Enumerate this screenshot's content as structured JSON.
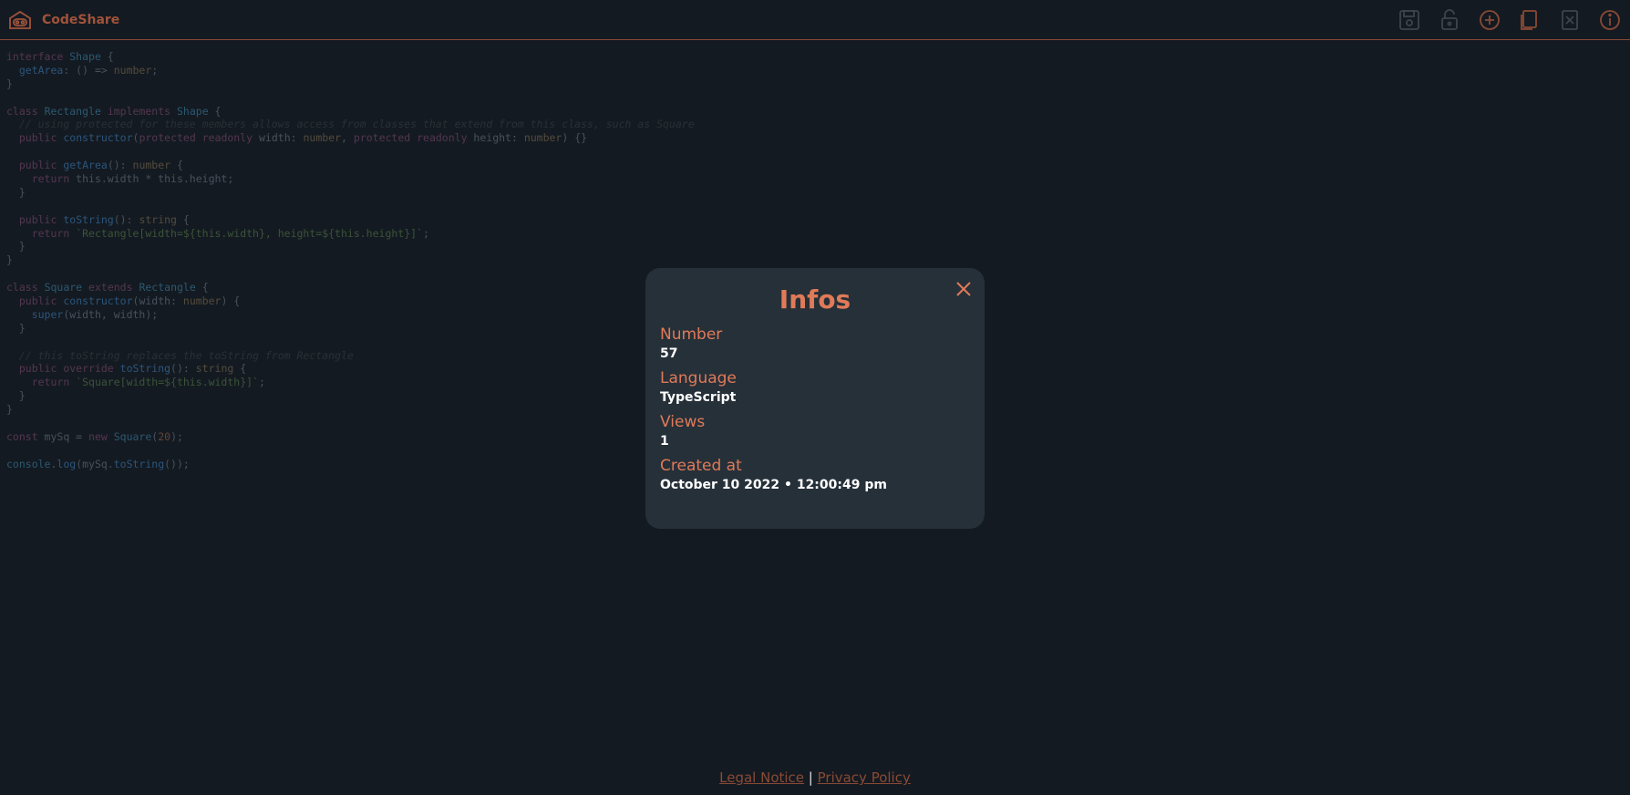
{
  "app": {
    "name": "CodeShare",
    "accent": "#a0533b"
  },
  "toolbar": {
    "buttons": [
      {
        "icon": "save-icon"
      },
      {
        "icon": "lock-icon"
      },
      {
        "icon": "plus-circle-icon"
      },
      {
        "icon": "copy-icon"
      },
      {
        "icon": "delete-icon"
      },
      {
        "icon": "info-icon"
      }
    ]
  },
  "code_lines": [
    "interface Shape {",
    "  getArea: () => number;",
    "}",
    "",
    "class Rectangle implements Shape {",
    "  // using protected for these members allows access from classes that extend from this class, such as Square",
    "  public constructor(protected readonly width: number, protected readonly height: number) {}",
    "",
    "  public getArea(): number {",
    "    return this.width * this.height;",
    "  }",
    "",
    "  public toString(): string {",
    "    return `Rectangle[width=${this.width}, height=${this.height}]`;",
    "  }",
    "}",
    "",
    "class Square extends Rectangle {",
    "  public constructor(width: number) {",
    "    super(width, width);",
    "  }",
    "",
    "  // this toString replaces the toString from Rectangle",
    "  public override toString(): string {",
    "    return `Square[width=${this.width}]`;",
    "  }",
    "}",
    "",
    "const mySq = new Square(20);",
    "",
    "console.log(mySq.toString());"
  ],
  "modal": {
    "title": "Infos",
    "fields": [
      {
        "label": "Number",
        "value": "57"
      },
      {
        "label": "Language",
        "value": "TypeScript"
      },
      {
        "label": "Views",
        "value": "1"
      },
      {
        "label": "Created at",
        "value": "October 10 2022 • 12:00:49 pm"
      }
    ]
  },
  "footer": {
    "legal": "Legal Notice",
    "separator": " | ",
    "privacy": "Privacy Policy"
  }
}
